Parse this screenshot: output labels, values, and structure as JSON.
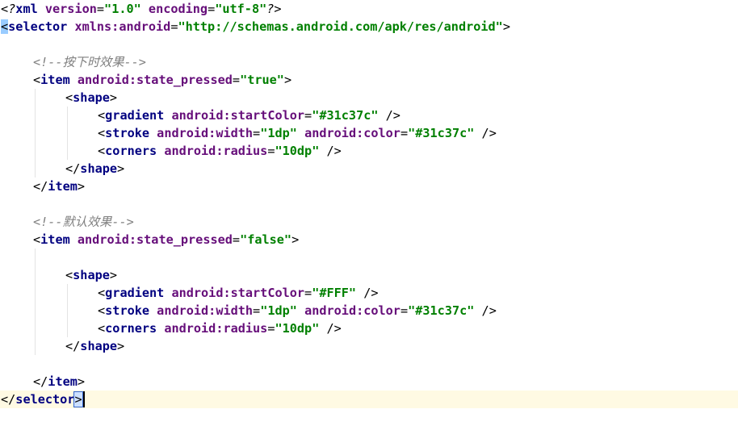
{
  "editor": {
    "language": "xml",
    "colors": {
      "tag": "#000080",
      "attribute": "#660e7a",
      "value": "#008000",
      "comment": "#808080",
      "current_line": "#fffae3"
    },
    "lines": [
      {
        "indent": 0,
        "tokens": [
          [
            "decl",
            "<?"
          ],
          [
            "kw",
            "xml "
          ],
          [
            "attr",
            "version"
          ],
          [
            "punct",
            "="
          ],
          [
            "val",
            "\"1.0\""
          ],
          [
            "punct",
            " "
          ],
          [
            "attr",
            "encoding"
          ],
          [
            "punct",
            "="
          ],
          [
            "val",
            "\"utf-8\""
          ],
          [
            "decl",
            "?>"
          ]
        ]
      },
      {
        "indent": 0,
        "tokens": [
          [
            "bracket",
            "<"
          ],
          [
            "tag",
            "selector "
          ],
          [
            "attr",
            "xmlns:android"
          ],
          [
            "punct",
            "="
          ],
          [
            "val",
            "\"http://schemas.android.com/apk/res/android\""
          ],
          [
            "punct",
            ">"
          ]
        ]
      },
      {
        "indent": 0,
        "tokens": []
      },
      {
        "indent": 1,
        "tokens": [
          [
            "comment",
            "<!--按下时效果-->"
          ]
        ]
      },
      {
        "indent": 1,
        "tokens": [
          [
            "punct",
            "<"
          ],
          [
            "tag",
            "item "
          ],
          [
            "attr",
            "android:state_pressed"
          ],
          [
            "punct",
            "="
          ],
          [
            "val",
            "\"true\""
          ],
          [
            "punct",
            ">"
          ]
        ]
      },
      {
        "indent": 2,
        "tokens": [
          [
            "punct",
            "<"
          ],
          [
            "tag",
            "shape"
          ],
          [
            "punct",
            ">"
          ]
        ]
      },
      {
        "indent": 3,
        "tokens": [
          [
            "punct",
            "<"
          ],
          [
            "tag",
            "gradient "
          ],
          [
            "attr",
            "android:startColor"
          ],
          [
            "punct",
            "="
          ],
          [
            "val",
            "\"#31c37c\""
          ],
          [
            "punct",
            " />"
          ]
        ]
      },
      {
        "indent": 3,
        "tokens": [
          [
            "punct",
            "<"
          ],
          [
            "tag",
            "stroke "
          ],
          [
            "attr",
            "android:width"
          ],
          [
            "punct",
            "="
          ],
          [
            "val",
            "\"1dp\""
          ],
          [
            "punct",
            " "
          ],
          [
            "attr",
            "android:color"
          ],
          [
            "punct",
            "="
          ],
          [
            "val",
            "\"#31c37c\""
          ],
          [
            "punct",
            " />"
          ]
        ]
      },
      {
        "indent": 3,
        "tokens": [
          [
            "punct",
            "<"
          ],
          [
            "tag",
            "corners "
          ],
          [
            "attr",
            "android:radius"
          ],
          [
            "punct",
            "="
          ],
          [
            "val",
            "\"10dp\""
          ],
          [
            "punct",
            " />"
          ]
        ]
      },
      {
        "indent": 2,
        "tokens": [
          [
            "punct",
            "</"
          ],
          [
            "tag",
            "shape"
          ],
          [
            "punct",
            ">"
          ]
        ]
      },
      {
        "indent": 1,
        "tokens": [
          [
            "punct",
            "</"
          ],
          [
            "tag",
            "item"
          ],
          [
            "punct",
            ">"
          ]
        ]
      },
      {
        "indent": 0,
        "tokens": []
      },
      {
        "indent": 1,
        "tokens": [
          [
            "comment",
            "<!--默认效果-->"
          ]
        ]
      },
      {
        "indent": 1,
        "tokens": [
          [
            "punct",
            "<"
          ],
          [
            "tag",
            "item "
          ],
          [
            "attr",
            "android:state_pressed"
          ],
          [
            "punct",
            "="
          ],
          [
            "val",
            "\"false\""
          ],
          [
            "punct",
            ">"
          ]
        ]
      },
      {
        "indent": 0,
        "tokens": []
      },
      {
        "indent": 2,
        "tokens": [
          [
            "punct",
            "<"
          ],
          [
            "tag",
            "shape"
          ],
          [
            "punct",
            ">"
          ]
        ]
      },
      {
        "indent": 3,
        "tokens": [
          [
            "punct",
            "<"
          ],
          [
            "tag",
            "gradient "
          ],
          [
            "attr",
            "android:startColor"
          ],
          [
            "punct",
            "="
          ],
          [
            "val",
            "\"#FFF\""
          ],
          [
            "punct",
            " />"
          ]
        ]
      },
      {
        "indent": 3,
        "tokens": [
          [
            "punct",
            "<"
          ],
          [
            "tag",
            "stroke "
          ],
          [
            "attr",
            "android:width"
          ],
          [
            "punct",
            "="
          ],
          [
            "val",
            "\"1dp\""
          ],
          [
            "punct",
            " "
          ],
          [
            "attr",
            "android:color"
          ],
          [
            "punct",
            "="
          ],
          [
            "val",
            "\"#31c37c\""
          ],
          [
            "punct",
            " />"
          ]
        ]
      },
      {
        "indent": 3,
        "tokens": [
          [
            "punct",
            "<"
          ],
          [
            "tag",
            "corners "
          ],
          [
            "attr",
            "android:radius"
          ],
          [
            "punct",
            "="
          ],
          [
            "val",
            "\"10dp\""
          ],
          [
            "punct",
            " />"
          ]
        ]
      },
      {
        "indent": 2,
        "tokens": [
          [
            "punct",
            "</"
          ],
          [
            "tag",
            "shape"
          ],
          [
            "punct",
            ">"
          ]
        ]
      },
      {
        "indent": 0,
        "tokens": []
      },
      {
        "indent": 1,
        "tokens": [
          [
            "punct",
            "</"
          ],
          [
            "tag",
            "item"
          ],
          [
            "punct",
            ">"
          ]
        ]
      },
      {
        "indent": 0,
        "current": true,
        "tokens": [
          [
            "punct",
            "</"
          ],
          [
            "tag",
            "selector"
          ],
          [
            "bracketend",
            ">"
          ]
        ]
      }
    ]
  }
}
